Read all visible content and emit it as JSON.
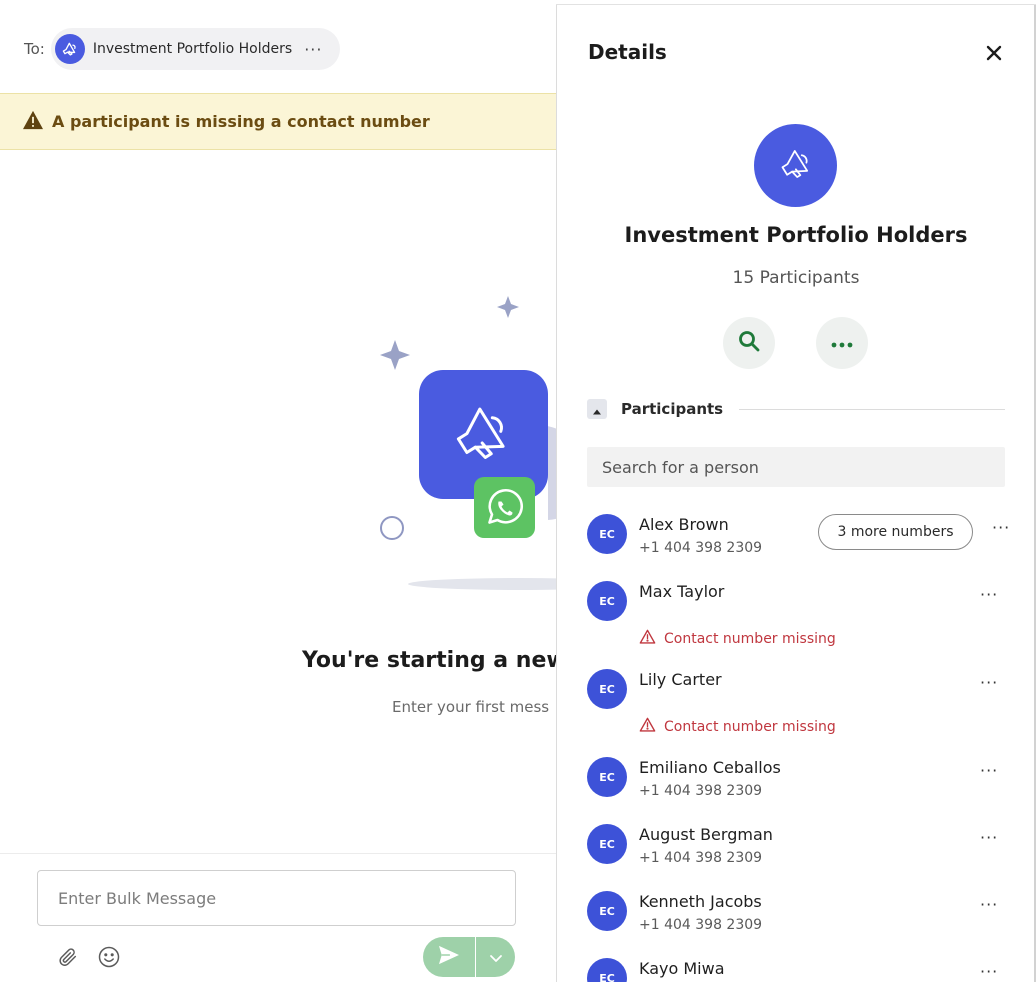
{
  "compose": {
    "to_label": "To:",
    "recipient_chip": "Investment Portfolio Holders",
    "chip_more": "···",
    "warning": "A participant is missing a contact number",
    "empty_title": "You're starting a new",
    "empty_subtitle": "Enter your first mess",
    "input_placeholder": "Enter Bulk Message"
  },
  "details": {
    "title": "Details",
    "group_name": "Investment Portfolio Holders",
    "participant_count": "15 Participants",
    "section_label": "Participants",
    "search_placeholder": "Search for a person",
    "more_glyph": "···",
    "participants": [
      {
        "initials": "EC",
        "name": "Alex Brown",
        "phone": "+1 404 398 2309",
        "extra": "3 more numbers"
      },
      {
        "initials": "EC",
        "name": "Max Taylor",
        "missing": "Contact number missing"
      },
      {
        "initials": "EC",
        "name": "Lily Carter",
        "missing": "Contact number missing"
      },
      {
        "initials": "EC",
        "name": "Emiliano Ceballos",
        "phone": "+1 404 398 2309"
      },
      {
        "initials": "EC",
        "name": "August Bergman",
        "phone": "+1 404 398 2309"
      },
      {
        "initials": "EC",
        "name": "Kenneth Jacobs",
        "phone": "+1 404 398 2309"
      },
      {
        "initials": "EC",
        "name": "Kayo Miwa"
      }
    ]
  },
  "colors": {
    "brand_blue": "#4a5be0",
    "whatsapp_green": "#5dc363",
    "warning_bg": "#fbf5d6",
    "error_red": "#c0373f",
    "send_green": "#9ed1a9"
  },
  "icons": [
    "megaphone-icon",
    "warning-triangle-icon",
    "whatsapp-icon",
    "paperclip-icon",
    "emoji-icon",
    "send-icon",
    "chevron-down-icon",
    "close-icon",
    "search-icon",
    "ellipsis-icon",
    "caret-up-icon"
  ]
}
